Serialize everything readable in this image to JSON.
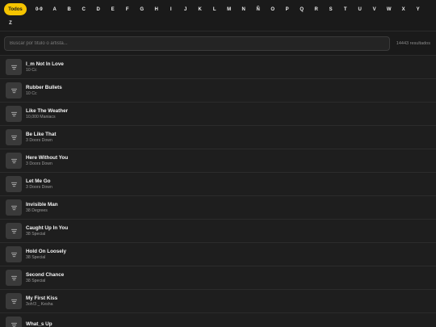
{
  "filters": {
    "active": "Todos",
    "items": [
      "Todos",
      "0-9",
      "A",
      "B",
      "C",
      "D",
      "E",
      "F",
      "G",
      "H",
      "I",
      "J",
      "K",
      "L",
      "M",
      "N",
      "Ñ",
      "O",
      "P",
      "Q",
      "R",
      "S",
      "T",
      "U",
      "V",
      "W",
      "X",
      "Y",
      "Z"
    ]
  },
  "search": {
    "placeholder": "Buscar por título o artista...",
    "value": "",
    "results_count": "14443 resultados"
  },
  "songs": [
    {
      "title": "I_m Not In Love",
      "artist": "10 Cc"
    },
    {
      "title": "Rubber Bullets",
      "artist": "10 Cc"
    },
    {
      "title": "Like The Weather",
      "artist": "10,000 Maniacs"
    },
    {
      "title": "Be Like That",
      "artist": "3 Doors Down"
    },
    {
      "title": "Here Without You",
      "artist": "3 Doors Down"
    },
    {
      "title": "Let Me Go",
      "artist": "3 Doors Down"
    },
    {
      "title": "Invisible Man",
      "artist": "38 Degrees"
    },
    {
      "title": "Caught Up In You",
      "artist": "38 Special"
    },
    {
      "title": "Hold On Loosely",
      "artist": "38 Special"
    },
    {
      "title": "Second Chance",
      "artist": "38 Special"
    },
    {
      "title": "My First Kiss",
      "artist": "3oh!3 _ Kesha"
    },
    {
      "title": "What_s Up",
      "artist": ""
    }
  ],
  "colors": {
    "accent": "#f5c400",
    "background": "#1f1f1f",
    "thumb": "#3a3a3a"
  },
  "icons": {
    "song_thumb": "lines-icon"
  }
}
